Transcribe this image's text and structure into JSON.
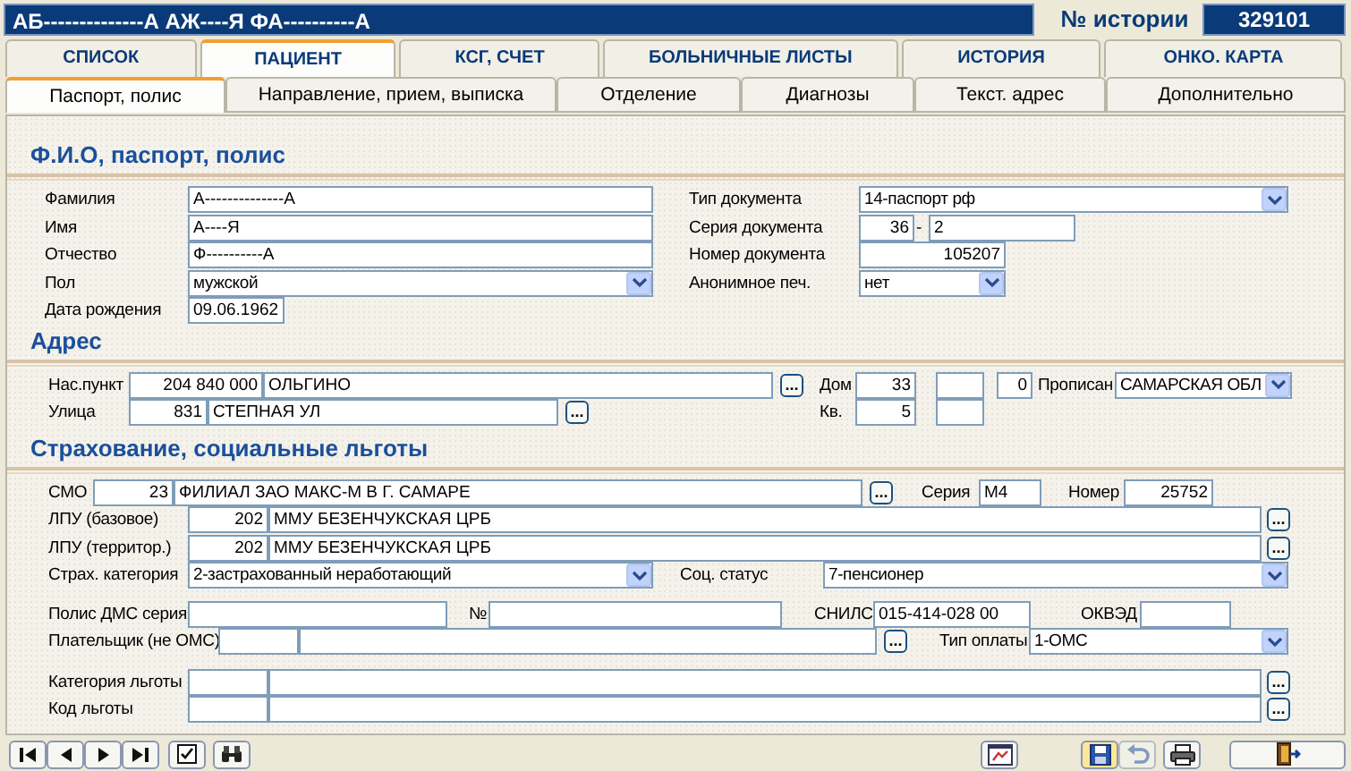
{
  "header": {
    "patient_name": "АБ--------------А АЖ----Я ФА----------А",
    "history_label": "№ истории",
    "history_number": "329101"
  },
  "tabs": [
    {
      "label": "СПИСОК",
      "selected": false
    },
    {
      "label": "ПАЦИЕНТ",
      "selected": true
    },
    {
      "label": "КСГ, СЧЕТ",
      "selected": false
    },
    {
      "label": "БОЛЬНИЧНЫЕ ЛИСТЫ",
      "selected": false
    },
    {
      "label": "ИСТОРИЯ",
      "selected": false
    },
    {
      "label": "ОНКО. КАРТА",
      "selected": false
    }
  ],
  "subtabs": [
    {
      "label": "Паспорт, полис",
      "selected": true
    },
    {
      "label": "Направление, прием, выписка",
      "selected": false
    },
    {
      "label": "Отделение",
      "selected": false
    },
    {
      "label": "Диагнозы",
      "selected": false
    },
    {
      "label": "Текст. адрес",
      "selected": false
    },
    {
      "label": "Дополнительно",
      "selected": false
    }
  ],
  "sections": [
    {
      "title": "Ф.И.О, паспорт, полис",
      "rows": [
        {
          "fields": [
            {
              "kind": "label",
              "text": "Фамилия"
            },
            {
              "kind": "input",
              "value": "А--------------А"
            },
            {
              "kind": "label",
              "text": "Тип документа"
            },
            {
              "kind": "select",
              "value": "14-паспорт рф"
            }
          ]
        },
        {
          "fields": [
            {
              "kind": "label",
              "text": "Имя"
            },
            {
              "kind": "input",
              "value": "А----Я"
            },
            {
              "kind": "label",
              "text": "Серия документа"
            },
            {
              "kind": "input",
              "value": "36"
            },
            {
              "kind": "label",
              "text": "-"
            },
            {
              "kind": "input",
              "value": "2"
            }
          ]
        },
        {
          "fields": [
            {
              "kind": "label",
              "text": "Отчество"
            },
            {
              "kind": "input",
              "value": "Ф----------А"
            },
            {
              "kind": "label",
              "text": "Номер документа"
            },
            {
              "kind": "input",
              "value": "105207"
            }
          ]
        },
        {
          "fields": [
            {
              "kind": "label",
              "text": "Пол"
            },
            {
              "kind": "select",
              "value": "мужской"
            },
            {
              "kind": "label",
              "text": "Анонимное печ."
            },
            {
              "kind": "select",
              "value": "нет"
            }
          ]
        },
        {
          "fields": [
            {
              "kind": "label",
              "text": "Дата рождения"
            },
            {
              "kind": "input",
              "value": "09.06.1962"
            }
          ]
        }
      ]
    },
    {
      "title": "Адрес",
      "rows": [
        {
          "fields": [
            {
              "kind": "label",
              "text": "Нас.пункт"
            },
            {
              "kind": "input",
              "value": "204 840 000"
            },
            {
              "kind": "input",
              "value": "ОЛЬГИНО"
            },
            {
              "kind": "button",
              "text": "..."
            },
            {
              "kind": "label",
              "text": "Дом"
            },
            {
              "kind": "input",
              "value": "33"
            },
            {
              "kind": "input"
            },
            {
              "kind": "input",
              "value": "0"
            },
            {
              "kind": "label",
              "text": "Прописан"
            },
            {
              "kind": "select",
              "value": "САМАРСКАЯ ОБЛ"
            }
          ]
        },
        {
          "fields": [
            {
              "kind": "label",
              "text": "Улица"
            },
            {
              "kind": "input",
              "value": "831"
            },
            {
              "kind": "input",
              "value": "СТЕПНАЯ УЛ"
            },
            {
              "kind": "button",
              "text": "..."
            },
            {
              "kind": "label",
              "text": "Кв."
            },
            {
              "kind": "input",
              "value": "5"
            },
            {
              "kind": "input"
            }
          ]
        }
      ]
    },
    {
      "title": "Страхование, социальные льготы",
      "rows": [
        {
          "fields": [
            {
              "kind": "label",
              "text": "СМО"
            },
            {
              "kind": "input",
              "value": "23"
            },
            {
              "kind": "input",
              "value": "ФИЛИАЛ ЗАО МАКС-М В Г. САМАРЕ"
            },
            {
              "kind": "button",
              "text": "..."
            },
            {
              "kind": "label",
              "text": "Серия"
            },
            {
              "kind": "input",
              "value": "М4"
            },
            {
              "kind": "label",
              "text": "Номер"
            },
            {
              "kind": "input",
              "value": "25752"
            }
          ]
        },
        {
          "fields": [
            {
              "kind": "label",
              "text": "ЛПУ (базовое)"
            },
            {
              "kind": "input",
              "value": "202"
            },
            {
              "kind": "input",
              "value": "ММУ БЕЗЕНЧУКСКАЯ ЦРБ"
            },
            {
              "kind": "button",
              "text": "..."
            }
          ]
        },
        {
          "fields": [
            {
              "kind": "label",
              "text": "ЛПУ (территор.)"
            },
            {
              "kind": "input",
              "value": "202"
            },
            {
              "kind": "input",
              "value": "ММУ БЕЗЕНЧУКСКАЯ ЦРБ"
            },
            {
              "kind": "button",
              "text": "..."
            }
          ]
        },
        {
          "fields": [
            {
              "kind": "label",
              "text": "Страх. категория"
            },
            {
              "kind": "select",
              "value": "2-застрахованный неработающий"
            },
            {
              "kind": "label",
              "text": "Соц. статус"
            },
            {
              "kind": "select",
              "value": "7-пенсионер"
            }
          ]
        },
        {
          "fields": [
            {
              "kind": "label",
              "text": "Полис ДМС серия"
            },
            {
              "kind": "input"
            },
            {
              "kind": "label",
              "text": "№"
            },
            {
              "kind": "input"
            },
            {
              "kind": "label",
              "text": "СНИЛС"
            },
            {
              "kind": "input",
              "value": "015-414-028 00"
            },
            {
              "kind": "label",
              "text": "ОКВЭД"
            },
            {
              "kind": "input"
            }
          ]
        },
        {
          "fields": [
            {
              "kind": "label",
              "text": "Плательщик (не ОМС)"
            },
            {
              "kind": "input"
            },
            {
              "kind": "input"
            },
            {
              "kind": "button",
              "text": "..."
            },
            {
              "kind": "label",
              "text": "Тип оплаты"
            },
            {
              "kind": "select",
              "value": "1-ОМС"
            }
          ]
        },
        {
          "fields": [
            {
              "kind": "label",
              "text": "Категория льготы"
            },
            {
              "kind": "input"
            },
            {
              "kind": "input"
            },
            {
              "kind": "button",
              "text": "..."
            }
          ]
        },
        {
          "fields": [
            {
              "kind": "label",
              "text": "Код льготы"
            },
            {
              "kind": "input"
            },
            {
              "kind": "input"
            },
            {
              "kind": "button",
              "text": "..."
            }
          ]
        }
      ]
    }
  ],
  "toolbar": [
    {
      "kind": "first",
      "disabled": false
    },
    {
      "kind": "prev",
      "disabled": false
    },
    {
      "kind": "next",
      "disabled": false
    },
    {
      "kind": "last",
      "disabled": false
    },
    {
      "kind": "check",
      "disabled": false
    },
    {
      "kind": "find",
      "disabled": false
    },
    {
      "kind": "report",
      "disabled": false
    },
    {
      "kind": "save",
      "disabled": false
    },
    {
      "kind": "undo",
      "disabled": true
    },
    {
      "kind": "print",
      "disabled": false
    },
    {
      "kind": "exit",
      "disabled": false
    }
  ]
}
